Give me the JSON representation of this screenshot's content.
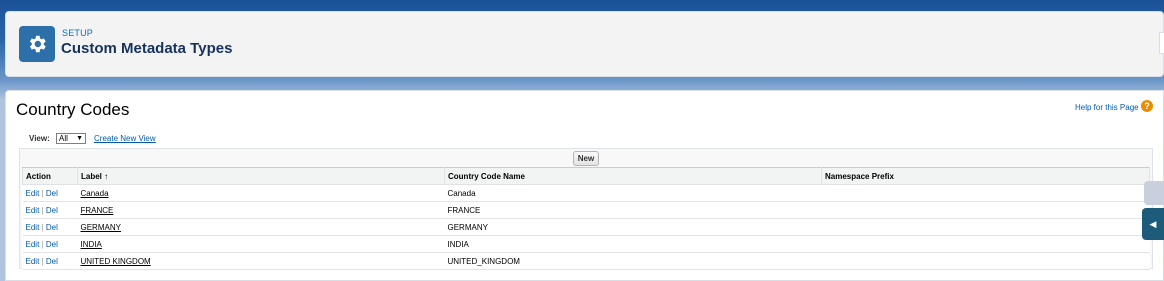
{
  "header": {
    "eyebrow": "SETUP",
    "title": "Custom Metadata Types",
    "icon": "gear-icon"
  },
  "page": {
    "title": "Country Codes",
    "help_link": "Help for this Page",
    "help_icon": "?"
  },
  "view": {
    "label": "View:",
    "selected": "All",
    "create_new_view": "Create New View"
  },
  "list": {
    "new_button": "New",
    "columns": [
      "Action",
      "Label ↑",
      "Country Code Name",
      "Namespace Prefix"
    ],
    "action_edit": "Edit",
    "action_del": "Del",
    "rows": [
      {
        "label": "Canada",
        "name": "Canada",
        "prefix": ""
      },
      {
        "label": "FRANCE",
        "name": "FRANCE",
        "prefix": ""
      },
      {
        "label": "GERMANY",
        "name": "GERMANY",
        "prefix": ""
      },
      {
        "label": "INDIA",
        "name": "INDIA",
        "prefix": ""
      },
      {
        "label": "UNITED KINGDOM",
        "name": "UNITED_KINGDOM",
        "prefix": ""
      }
    ]
  },
  "colors": {
    "brand_blue": "#1b5297",
    "link": "#015ba7",
    "icon_bg": "#2d6fa8",
    "help_orange": "#ea8c00"
  }
}
